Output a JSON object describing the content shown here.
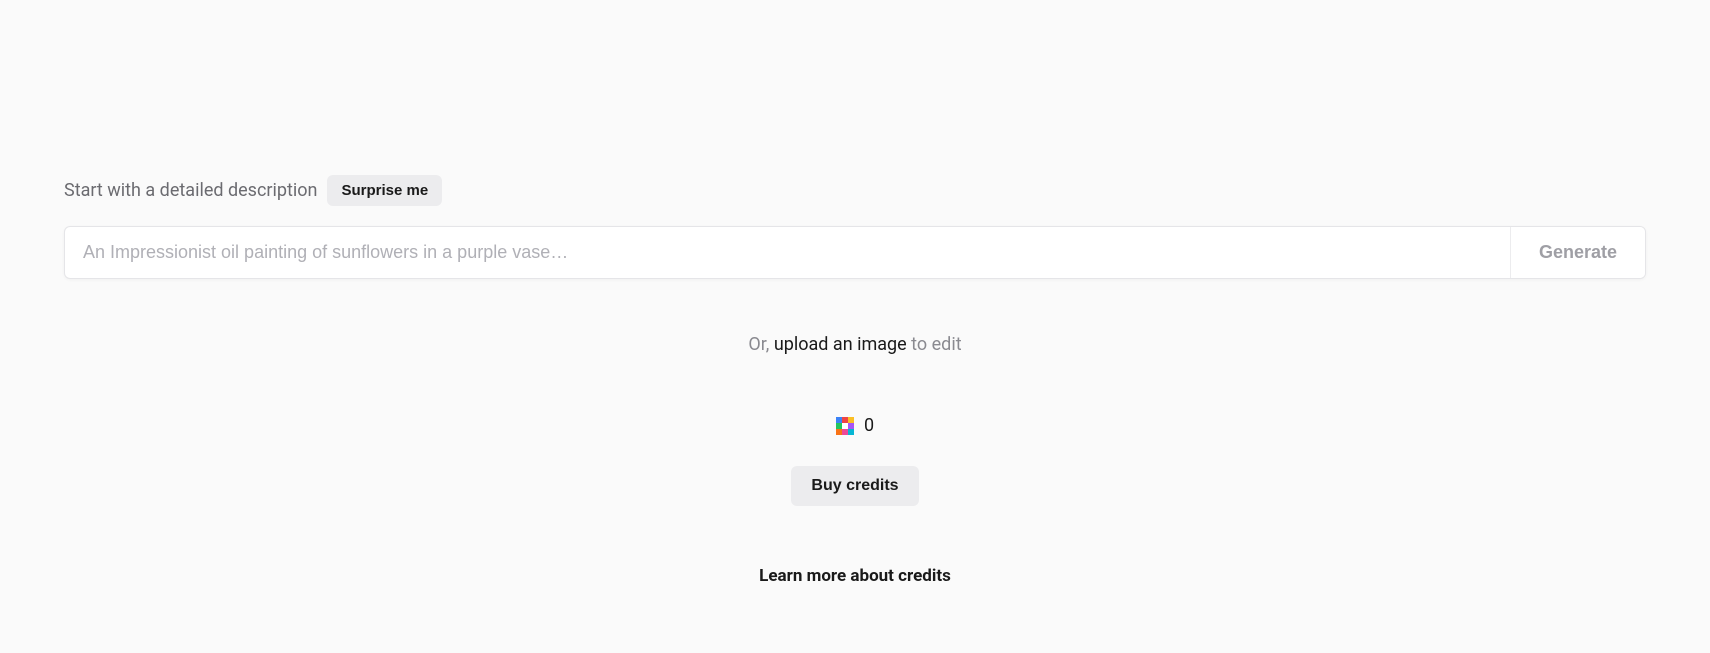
{
  "header": {
    "description_label": "Start with a detailed description",
    "surprise_label": "Surprise me"
  },
  "prompt": {
    "placeholder": "An Impressionist oil painting of sunflowers in a purple vase…",
    "value": "",
    "generate_label": "Generate"
  },
  "upload": {
    "prefix": "Or, ",
    "link_text": "upload an image",
    "suffix": " to edit"
  },
  "credits": {
    "count": "0",
    "buy_label": "Buy credits",
    "learn_more_label": "Learn more about credits"
  }
}
